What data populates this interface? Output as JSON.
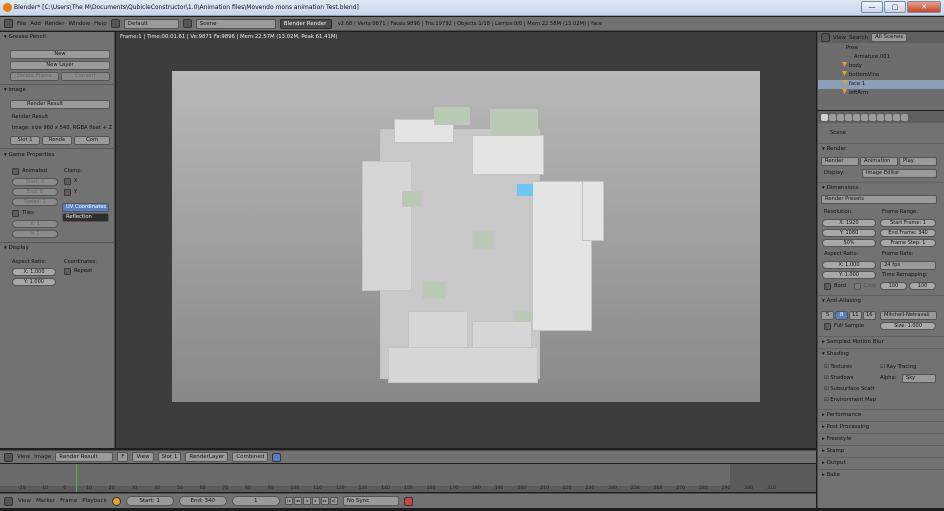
{
  "window": {
    "title": "Blender* [C:\\Users\\The M\\Documents\\QubicleConstructor\\1.0\\Animation files\\Movendo mons animation Test.blend]",
    "minimize": "—",
    "maximize": "▢",
    "close": "✕"
  },
  "topbar": {
    "menus": [
      "File",
      "Add",
      "Render",
      "Window",
      "Help"
    ],
    "screen_layout": "Default",
    "scene": "Scene",
    "engine": "Blender Render",
    "stats": "v2.68 | Verts:9871 | Faces:9896 | Tris:19792 | Objects:1/18 | Lamps:0/0 | Mem:22.58M (13.02M) | face"
  },
  "leftpanel": {
    "grease_pencil": "Grease Pencil",
    "new": "New",
    "new_layer": "New Layer",
    "delete_frame": "Delete Frame",
    "convert": "Convert",
    "image": "Image",
    "render_result": "Render Result",
    "render_result_label": "Render Result",
    "image_info": "Image: size 960 x 540, RGBA float + Z",
    "slot": "Slot 1",
    "render": "Rende",
    "comp": "Com",
    "game_properties": "Game Properties",
    "animated": "Animated",
    "start": "Start: 0",
    "end": "End: 0",
    "speed": "Speed: 1",
    "clamp": "Clamp:",
    "clamp_x": "X",
    "clamp_y": "Y",
    "tiles": "Tiles",
    "tile_x": "X: 1",
    "tile_y": "Y: 1",
    "uv_coordinates": "UV Coordinates",
    "reflection": "Reflection",
    "display": "Display",
    "aspect_ratio": "Aspect Ratio:",
    "aspect_x": "X: 1.000",
    "aspect_y": "Y: 1.000",
    "coordinates": "Coordinates:",
    "repeat": "Repeat"
  },
  "viewport": {
    "info": "Frame:1 | Time:00:01.61 | Ve:9871 Fa:9896 | Mem:22.57M (13.02M, Peak 61.41M)"
  },
  "outliner": {
    "view": "View",
    "search": "Search",
    "all_scenes": "All Scenes",
    "rows": [
      "Pose",
      "Armature.001",
      "body",
      "bottomVine",
      "face",
      "leftArm"
    ],
    "face_count": "1"
  },
  "props": {
    "scene": "Scene",
    "render_head": "Render",
    "render_btn": "Render",
    "animation_btn": "Animation",
    "play_btn": "Play",
    "display_label": "Display:",
    "display_value": "Image Editor",
    "dimensions": "Dimensions",
    "render_presets": "Render Presets",
    "resolution": "Resolution:",
    "res_x": "X: 1920",
    "res_y": "Y: 1080",
    "res_pct": "50%",
    "frame_range": "Frame Range:",
    "start_frame": "Start Frame: 1",
    "end_frame": "End Frame: 340",
    "frame_step": "Frame Step: 1",
    "aspect_ratio": "Aspect Ratio:",
    "asp_x": "X: 1.000",
    "asp_y": "Y: 1.000",
    "frame_rate": "Frame Rate:",
    "fps": "24 fps",
    "time_remapping": "Time Remapping:",
    "remap_old": "100",
    "remap_new": "100",
    "border": "Bord",
    "crop": "Crop",
    "anti_aliasing": "Anti-Aliasing",
    "aa_levels": [
      "5",
      "8",
      "11",
      "16"
    ],
    "aa_filter": "Mitchell-Netravali",
    "full_sample": "Full Sample",
    "size": "Size: 1.000",
    "sampled_motion_blur": "Sampled Motion Blur",
    "shading": "Shading",
    "textures": "Textures",
    "ray_tracing": "Ray Tracing",
    "shadows": "Shadows",
    "alpha": "Alpha:",
    "alpha_value": "Sky",
    "subsurface": "Subsurface Scatt",
    "environment_map": "Environment Map",
    "performance": "Performance",
    "post_processing": "Post Processing",
    "freestyle": "Freestyle",
    "stamp": "Stamp",
    "output": "Output",
    "bake": "Bake"
  },
  "imgbar": {
    "view": "View",
    "image": "Image",
    "render_result": "Render Result",
    "f": "F",
    "view_menu": "View",
    "slot": "Slot 1",
    "layer": "RenderLayer",
    "pass": "Combined"
  },
  "timeline": {
    "ticks": [
      "-20",
      "-10",
      "0",
      "10",
      "20",
      "30",
      "40",
      "50",
      "60",
      "70",
      "80",
      "90",
      "100",
      "110",
      "120",
      "130",
      "140",
      "150",
      "160",
      "170",
      "180",
      "190",
      "200",
      "210",
      "220",
      "230",
      "240",
      "250",
      "260",
      "270",
      "280",
      "290",
      "300",
      "310"
    ],
    "view": "View",
    "marker": "Marker",
    "frame": "Frame",
    "playback": "Playback",
    "start": "Start: 1",
    "end": "End: 340",
    "current": "1",
    "sync": "No Sync"
  }
}
